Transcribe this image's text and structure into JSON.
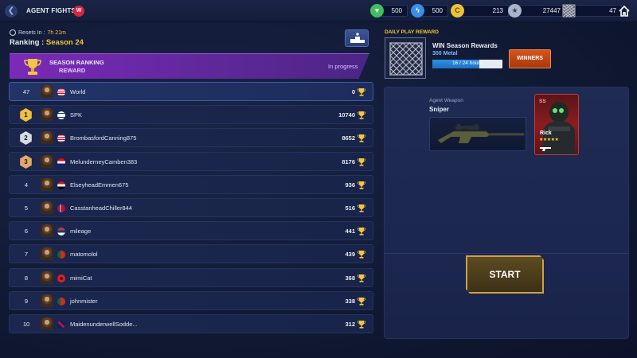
{
  "header": {
    "title": "AGENT FIGHTS -",
    "badge": "W",
    "resources": [
      {
        "icon": "gem-icon",
        "value": "500",
        "color": "#3fbf5f"
      },
      {
        "icon": "energy-icon",
        "value": "500",
        "color": "#3a8ee8"
      },
      {
        "icon": "coin-icon",
        "value": "213",
        "color": "#e8c23a"
      },
      {
        "icon": "medal-icon",
        "value": "27447",
        "color": "#aab4c8"
      },
      {
        "icon": "metal-icon",
        "value": "47",
        "color": "#8a8f9e"
      }
    ]
  },
  "left": {
    "resets_label": "Resets In :",
    "resets_time": "7h 21m",
    "ranking_label": "Ranking :",
    "season": "Season 24",
    "banner": {
      "title": "SEASON RANKING",
      "subtitle": "REWARD",
      "status": "In progress"
    },
    "rows": [
      {
        "rank": "47",
        "medal": "",
        "flag": "us",
        "name": "World",
        "score": "0"
      },
      {
        "rank": "1",
        "medal": "gold",
        "flag": "il",
        "name": "SPK",
        "score": "10740"
      },
      {
        "rank": "2",
        "medal": "silver",
        "flag": "us",
        "name": "BrombasfordCanning875",
        "score": "8652"
      },
      {
        "rank": "3",
        "medal": "bronze",
        "flag": "hr",
        "name": "MelunderneyCamben383",
        "score": "8176"
      },
      {
        "rank": "4",
        "medal": "",
        "flag": "eg",
        "name": "ElseyheadEmmen675",
        "score": "936"
      },
      {
        "rank": "5",
        "medal": "",
        "flag": "no",
        "name": "CasstanheadChiller844",
        "score": "516"
      },
      {
        "rank": "6",
        "medal": "",
        "flag": "rs",
        "name": "mileage",
        "score": "441"
      },
      {
        "rank": "7",
        "medal": "",
        "flag": "pt",
        "name": "matomolol",
        "score": "439"
      },
      {
        "rank": "8",
        "medal": "",
        "flag": "al",
        "name": "mimiCat",
        "score": "368"
      },
      {
        "rank": "9",
        "medal": "",
        "flag": "pt",
        "name": "johnmister",
        "score": "338"
      },
      {
        "rank": "10",
        "medal": "",
        "flag": "gb",
        "name": "MaidenunderwellSodde...",
        "score": "312"
      }
    ]
  },
  "right": {
    "daily_label": "DAILY PLAY REWARD",
    "reward_title": "WIN Season Rewards",
    "reward_sub": "300 Metal",
    "progress_text": "16 / 24 hours",
    "progress_fraction": 0.667,
    "winners_label": "WINNERS",
    "weapon_caption": "Agent Weapon",
    "weapon_name": "Sniper",
    "agent": {
      "tier": "SS",
      "name": "Rick",
      "stars": "★★★★★"
    },
    "start_label": "START"
  }
}
